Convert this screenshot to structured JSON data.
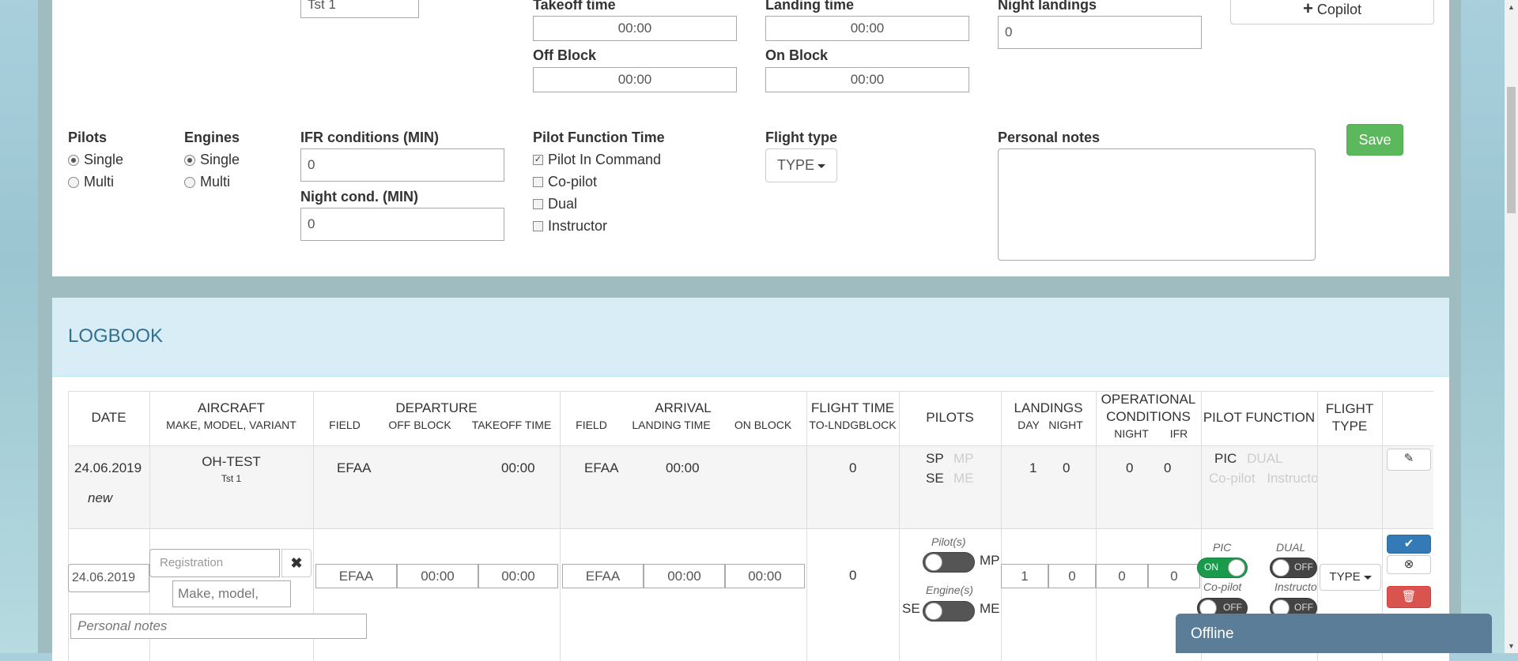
{
  "flight_form": {
    "copilot_name_value": "Tst 1",
    "takeoff_time_label": "Takeoff time",
    "takeoff_time_value": "00:00",
    "landing_time_label": "Landing time",
    "landing_time_value": "00:00",
    "night_landings_label": "Night landings",
    "night_landings_value": "0",
    "copilot_button_label": "Copilot",
    "off_block_label": "Off Block",
    "off_block_value": "00:00",
    "on_block_label": "On Block",
    "on_block_value": "00:00",
    "pilots_label": "Pilots",
    "pilots_options": [
      "Single",
      "Multi"
    ],
    "engines_label": "Engines",
    "engines_options": [
      "Single",
      "Multi"
    ],
    "ifr_label": "IFR conditions (MIN)",
    "ifr_value": "0",
    "night_cond_label": "Night cond. (MIN)",
    "night_cond_value": "0",
    "pilot_function_label": "Pilot Function Time",
    "pilot_function_options": [
      "Pilot In Command",
      "Co-pilot",
      "Dual",
      "Instructor"
    ],
    "flight_type_label": "Flight type",
    "flight_type_button": "TYPE",
    "personal_notes_label": "Personal notes",
    "save_label": "Save"
  },
  "logbook": {
    "title": "LOGBOOK",
    "headers": {
      "date": "DATE",
      "aircraft": "AIRCRAFT",
      "aircraft_sub": "MAKE, MODEL, VARIANT",
      "departure": "DEPARTURE",
      "departure_sub": [
        "FIELD",
        "OFF BLOCK",
        "TAKEOFF TIME"
      ],
      "arrival": "ARRIVAL",
      "arrival_sub": [
        "FIELD",
        "LANDING TIME",
        "ON BLOCK"
      ],
      "flight_time": "FLIGHT TIME",
      "flight_time_sub": "TO-LNDGBLOCK",
      "pilots": "PILOTS",
      "landings": "LANDINGS",
      "landings_sub": [
        "DAY",
        "NIGHT"
      ],
      "op_conditions": "OPERATIONAL CONDITIONS",
      "op_conditions_sub": [
        "NIGHT",
        "IFR"
      ],
      "pilot_function": "PILOT FUNCTION",
      "flight_type": "FLIGHT TYPE"
    },
    "row": {
      "date": "24.06.2019",
      "status": "new",
      "registration": "OH-TEST",
      "model": "Tst 1",
      "dep_field": "EFAA",
      "takeoff_time": "00:00",
      "arr_field": "EFAA",
      "landing_time": "00:00",
      "flight_time": "0",
      "pilots_sp": "SP",
      "pilots_mp": "MP",
      "pilots_se": "SE",
      "pilots_me": "ME",
      "landings_day": "1",
      "landings_night": "0",
      "night": "0",
      "ifr": "0",
      "pic": "PIC",
      "dual": "DUAL",
      "copilot": "Co-pilot",
      "instructor": "Instructor"
    },
    "edit_row": {
      "date_value": "24.06.2019",
      "registration_placeholder": "Registration",
      "model_placeholder": "Make, model, variant",
      "dep_field": "EFAA",
      "off_block": "00:00",
      "takeoff_time": "00:00",
      "arr_field": "EFAA",
      "landing_time": "00:00",
      "on_block": "00:00",
      "flight_time": "0",
      "pilots_caption": "Pilot(s)",
      "sp": "SP",
      "mp": "MP",
      "engines_caption": "Engine(s)",
      "se": "SE",
      "me": "ME",
      "landings_day": "1",
      "landings_night": "0",
      "night": "0",
      "ifr": "0",
      "pic_caption": "PIC",
      "dual_caption": "DUAL",
      "copilot_caption": "Co-pilot",
      "instructor_caption": "Instructo",
      "toggle_on": "ON",
      "toggle_off": "OFF",
      "type_button": "TYPE",
      "personal_notes_placeholder": "Personal notes"
    }
  },
  "chat": {
    "status": "Offline"
  }
}
